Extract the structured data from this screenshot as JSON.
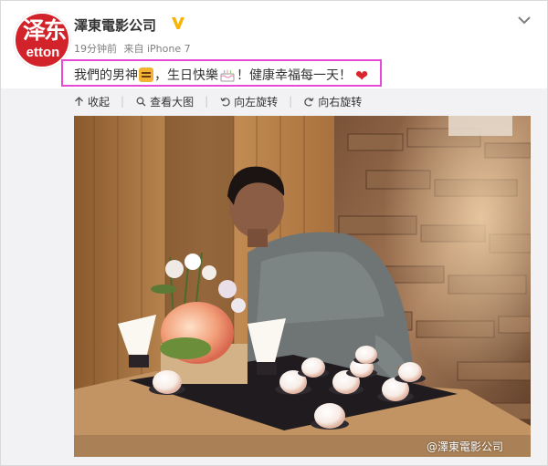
{
  "post": {
    "user_name": "澤東電影公司",
    "time": "19分钟前",
    "source": "来自 iPhone 7",
    "text_part1": "我們的男神",
    "text_part2": "，生日快樂",
    "text_part3": "！健康幸福每一天！",
    "avatar_text": "泽东",
    "avatar_sub": "etton"
  },
  "toolbar": {
    "collapse": "收起",
    "view_large": "查看大图",
    "rotate_left": "向左旋转",
    "rotate_right": "向右旋转"
  },
  "photo": {
    "watermark": "@澤東電影公司"
  },
  "icons": {
    "verified": "verified-v-icon",
    "chevron": "chevron-down-icon",
    "collapse": "arrow-up-icon",
    "zoom": "magnifier-icon",
    "rotate_left": "rotate-left-icon",
    "rotate_right": "rotate-right-icon"
  },
  "colors": {
    "highlight_border": "#e84ad8",
    "avatar_bg": "#d2232a",
    "verified": "#f7b500",
    "expand_bg": "#f2f2f5"
  }
}
